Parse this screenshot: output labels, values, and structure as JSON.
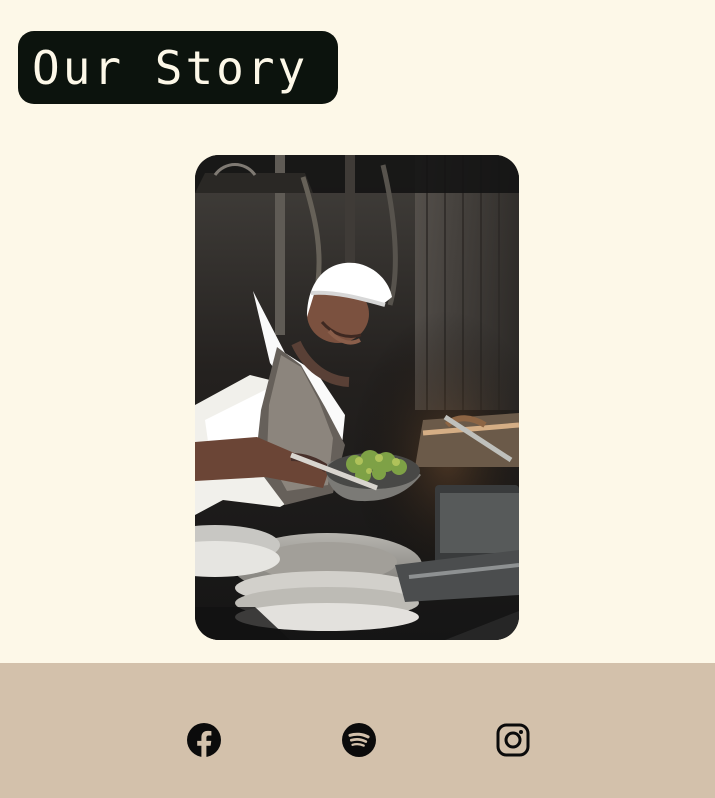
{
  "header": {
    "title": "Our Story"
  },
  "hero": {
    "image_label": "chef-cooking-photo",
    "image_alt": ""
  },
  "footer": {
    "background_color": "#d3c1ab",
    "social": [
      {
        "name": "facebook",
        "icon": "facebook-icon"
      },
      {
        "name": "spotify",
        "icon": "spotify-icon"
      },
      {
        "name": "instagram",
        "icon": "instagram-icon"
      }
    ]
  },
  "colors": {
    "page_background": "#fdf8e8",
    "title_badge_background": "#0c130d",
    "title_text": "#fdf8e8",
    "icon_color": "#0b0b0b"
  }
}
